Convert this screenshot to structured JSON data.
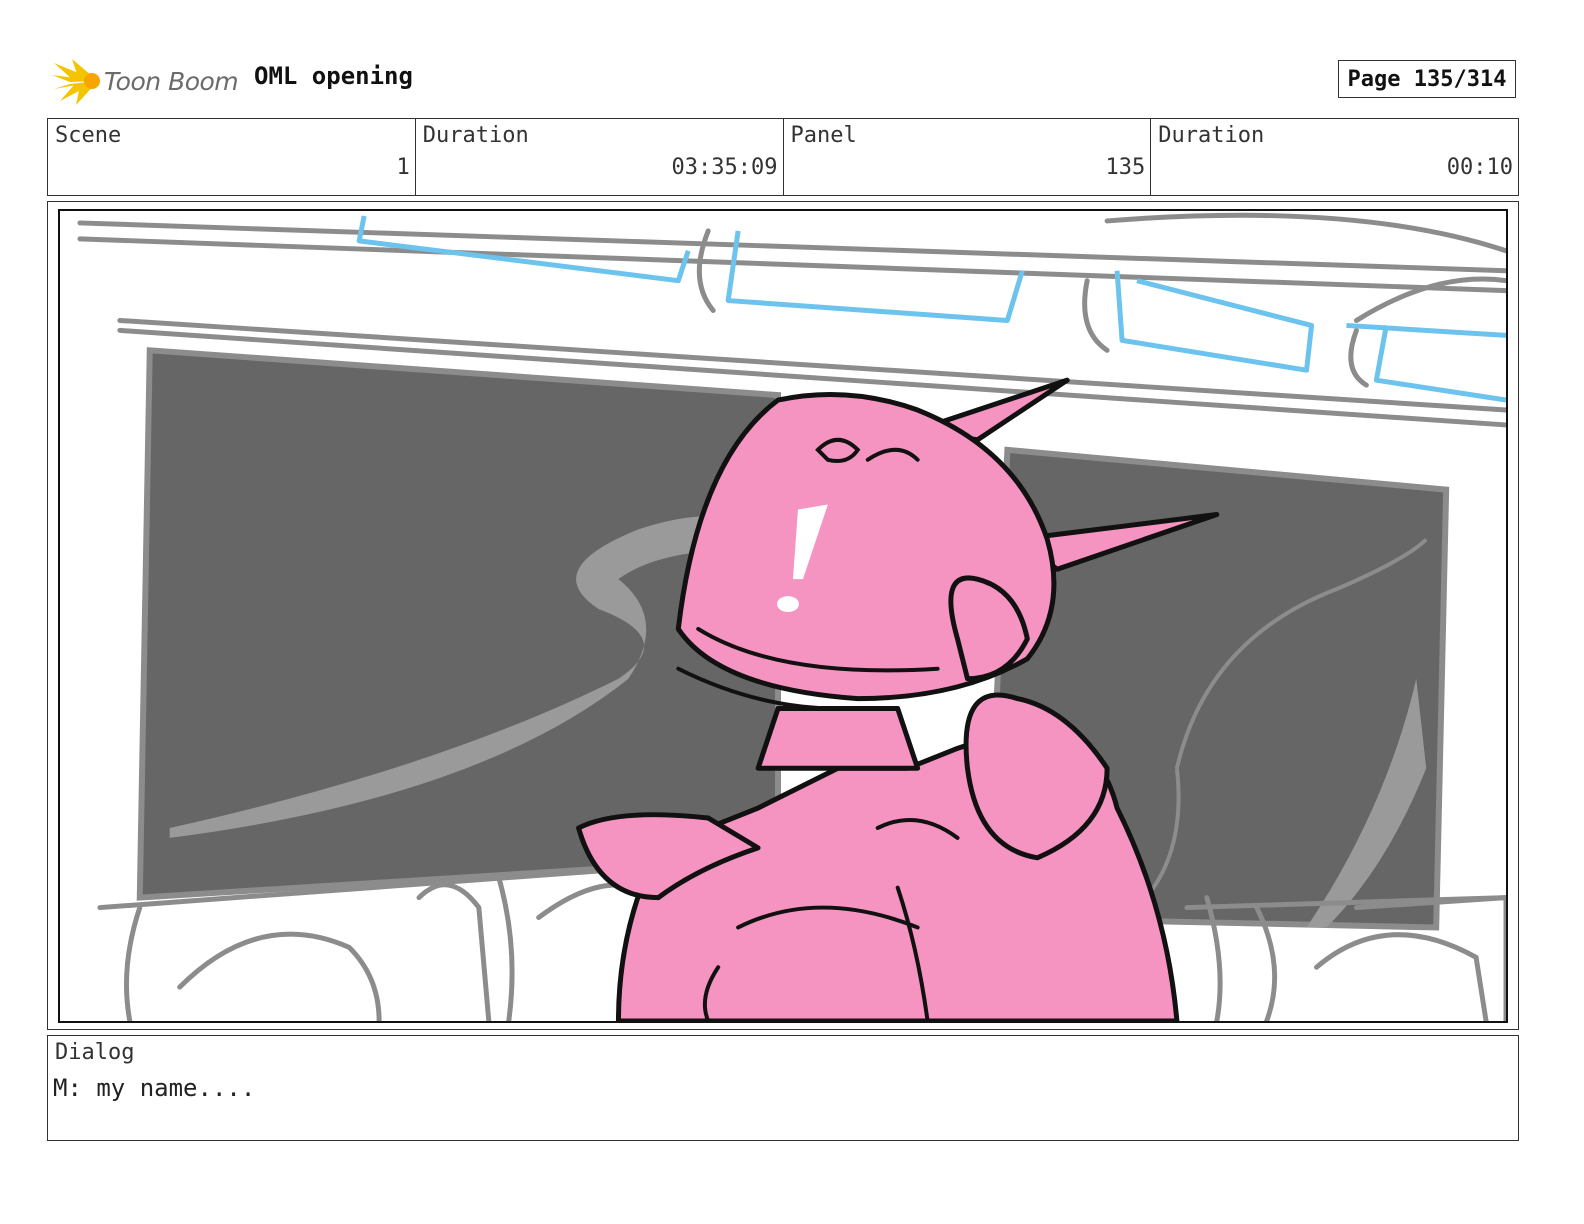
{
  "header": {
    "logo_text": "Toon Boom",
    "title": "OML opening",
    "page_label": "Page 135/314"
  },
  "info": {
    "scene_label": "Scene",
    "scene_value": "1",
    "duration_label": "Duration",
    "duration_value": "03:35:09",
    "panel_label": "Panel",
    "panel_value": "135",
    "panel_duration_label": "Duration",
    "panel_duration_value": "00:10"
  },
  "dialog": {
    "label": "Dialog",
    "text": "M: my name...."
  },
  "colors": {
    "character_fill": "#f594c0",
    "screen_dark": "#666666",
    "screen_swirl": "#9a9a9a",
    "sketch_gray": "#8c8c8c",
    "sketch_blue": "#6cc3ee",
    "logo_yellow": "#f5c400"
  }
}
